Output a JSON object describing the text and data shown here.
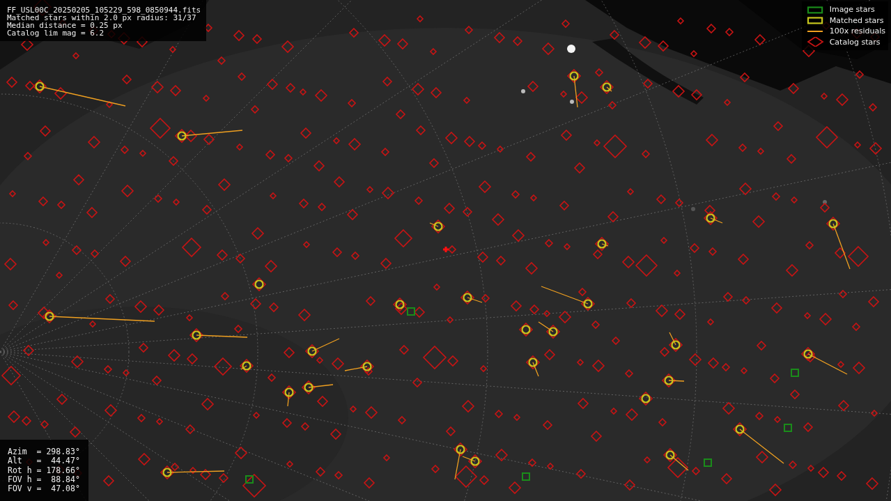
{
  "file_info": {
    "lines": [
      "FF_USL00C_20250205_105229_598_0850944.fits",
      "Matched stars within 2.0 px radius: 31/37",
      "Median distance = 0.25 px",
      "Catalog lim mag = 6.2"
    ]
  },
  "legend": [
    {
      "label": "Image stars",
      "color": "#1a8c1a"
    },
    {
      "kind": "matched",
      "label": "Matched stars",
      "color": "#c8c81e"
    },
    {
      "kind": "residual",
      "label": "100x residuals",
      "color": "#f0a020"
    },
    {
      "kind": "catalog",
      "label": "Catalog stars",
      "color": "#c81414"
    }
  ],
  "pointing": {
    "lines": [
      "Azim  = 298.83°",
      "Alt   =  44.47°",
      "Rot h = 178.66°",
      "FOV h =  88.84°",
      "FOV v =  47.08°"
    ]
  }
}
